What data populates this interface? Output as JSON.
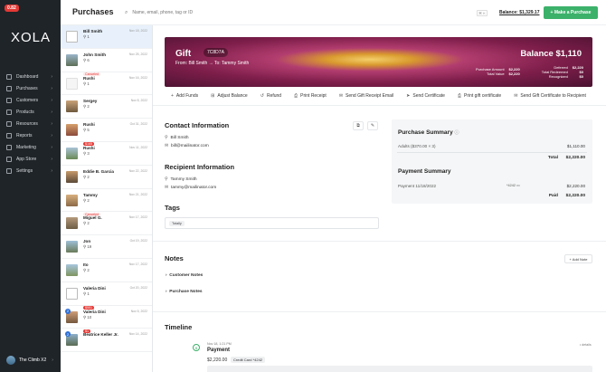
{
  "sidebar": {
    "badge": "0.82",
    "logo": "XOLA",
    "items": [
      {
        "label": "Dashboard",
        "icon": "dashboard-icon"
      },
      {
        "label": "Purchases",
        "icon": "purchases-icon"
      },
      {
        "label": "Customers",
        "icon": "customers-icon"
      },
      {
        "label": "Products",
        "icon": "products-icon"
      },
      {
        "label": "Resources",
        "icon": "resources-icon"
      },
      {
        "label": "Reports",
        "icon": "reports-icon"
      },
      {
        "label": "Marketing",
        "icon": "marketing-icon"
      },
      {
        "label": "App Store",
        "icon": "app-store-icon"
      },
      {
        "label": "Settings",
        "icon": "settings-icon"
      }
    ],
    "account": "The Climb X2"
  },
  "header": {
    "title": "Purchases",
    "search_placeholder": "Name, email, phone, tag or ID",
    "kbd": "⌘ K",
    "balance": "Balance: $1,329.17",
    "make_purchase": "+ Make a Purchase"
  },
  "list": [
    {
      "name": "Bill Smith",
      "count": "1",
      "date": "Nov 18, 2022",
      "selected": true
    },
    {
      "name": "John Smith",
      "count": "6",
      "date": "Nov 25, 2022",
      "tag": "Canceled",
      "tagType": "cancel"
    },
    {
      "name": "Rushi",
      "count": "1",
      "date": "Nov 16, 2022"
    },
    {
      "name": "Sergey",
      "count": "2",
      "date": "Nov 8, 2022"
    },
    {
      "name": "Rushi",
      "count": "5",
      "date": "Oct 31, 2022",
      "tag": "$165",
      "tagType": "red"
    },
    {
      "name": "Rushi",
      "count": "3",
      "date": "Nov 11, 2022"
    },
    {
      "name": "Eddie B. Garcia",
      "count": "2",
      "date": "Nov 22, 2022"
    },
    {
      "name": "Tammy",
      "count": "2",
      "date": "Nov 21, 2022",
      "tag": "Canceled",
      "tagType": "cancel"
    },
    {
      "name": "Miguel G.",
      "count": "2",
      "date": "Nov 17, 2022"
    },
    {
      "name": "Jon",
      "count": "19",
      "date": "Oct 19, 2022"
    },
    {
      "name": "Ito",
      "count": "2",
      "date": "Nov 17, 2022"
    },
    {
      "name": "Valeria Dini",
      "count": "1",
      "date": "Oct 20, 2022",
      "tag": "$551",
      "tagType": "red"
    },
    {
      "name": "Valeria Dini",
      "count": "10",
      "date": "Nov 5, 2022",
      "tag": "$1",
      "tagType": "red",
      "nbadge": "2"
    },
    {
      "name": "Beatrice Keller Jr.",
      "count": "",
      "date": "Nov 14, 2022",
      "nbadge": "2"
    }
  ],
  "banner": {
    "title": "Gift",
    "code": "7C8D7A",
    "from": "From: Bill Smith",
    "to": "To: Tammy Smith",
    "balance": "Balance $1,110",
    "purchase_amount_label": "Purchase Amount",
    "purchase_amount": "$2,220",
    "total_value_label": "Total Value",
    "total_value": "$2,220",
    "deferred_label": "Deferred",
    "deferred": "$2,220",
    "total_redeemed_label": "Total Redeemed",
    "total_redeemed": "$0",
    "recognized_label": "Recognized",
    "recognized": "$0"
  },
  "actions": [
    {
      "label": "Add Funds",
      "icon": "plus-icon"
    },
    {
      "label": "Adjust Balance",
      "icon": "adjust-icon"
    },
    {
      "label": "Refund",
      "icon": "refund-icon"
    },
    {
      "label": "Print Receipt",
      "icon": "print-icon"
    },
    {
      "label": "Send Gift Receipt Email",
      "icon": "email-icon"
    },
    {
      "label": "Send Certificate",
      "icon": "send-icon"
    },
    {
      "label": "Print gift certificate",
      "icon": "print-icon"
    },
    {
      "label": "Send Gift Certificate to Recipient",
      "icon": "email-icon"
    }
  ],
  "contact": {
    "title": "Contact Information",
    "name": "Bill Smith",
    "email": "bill@mailinator.com"
  },
  "recipient": {
    "title": "Recipient Information",
    "name": "Tammy Smith",
    "email": "tammy@mailinator.com"
  },
  "tags": {
    "title": "Tags",
    "items": [
      "Totally"
    ]
  },
  "summary": {
    "title": "Purchase Summary",
    "line_label": "Adults ($370.00 × 3)",
    "line_value": "$1,110.00",
    "total_label": "Total",
    "total_value": "$2,220.00",
    "payment_title": "Payment Summary",
    "payment_label": "Payment 11/18/2022",
    "payment_card": "*4242",
    "payment_value": "$2,220.00",
    "paid_label": "Paid",
    "paid_value": "$2,220.00"
  },
  "notes": {
    "title": "Notes",
    "add": "+ Add Note",
    "customer": "Customer Notes",
    "purchase": "Purchase Notes"
  },
  "timeline": {
    "title": "Timeline",
    "date": "Nov 18, 1:21 PM",
    "event": "Payment",
    "amount": "$2,220.00",
    "card": "Credit Card *4242",
    "more": "• details"
  }
}
